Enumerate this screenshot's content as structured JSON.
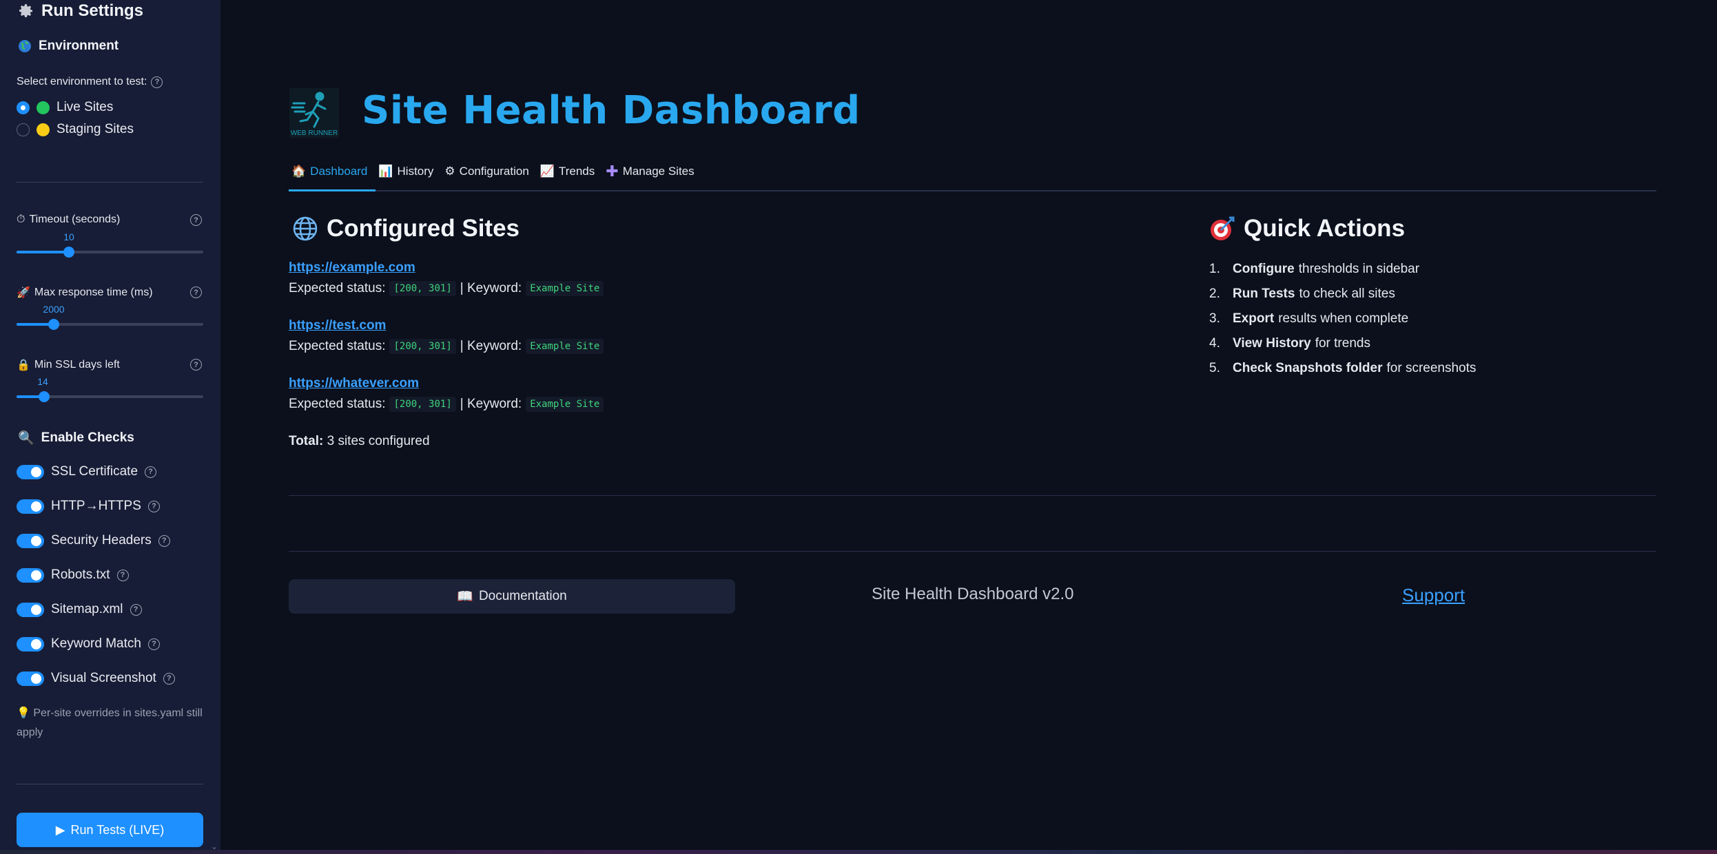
{
  "sidebar": {
    "title": "Run Settings",
    "environment_heading": "Environment",
    "env_select_label": "Select environment to test:",
    "env_options": [
      {
        "label": "Live Sites",
        "color": "#22c55e",
        "selected": true
      },
      {
        "label": "Staging Sites",
        "color": "#facc15",
        "selected": false
      }
    ],
    "timeout": {
      "label": "Timeout (seconds)",
      "value": "10",
      "fraction": 0.18
    },
    "max_response": {
      "label": "Max response time (ms)",
      "value": "2000",
      "fraction": 0.2
    },
    "min_ssl": {
      "label": "Min SSL days left",
      "value": "14",
      "fraction": 0.15
    },
    "checks_heading": "Enable Checks",
    "checks": [
      {
        "label": "SSL Certificate",
        "enabled": true
      },
      {
        "label": "HTTP→HTTPS",
        "enabled": true
      },
      {
        "label": "Security Headers",
        "enabled": true
      },
      {
        "label": "Robots.txt",
        "enabled": true
      },
      {
        "label": "Sitemap.xml",
        "enabled": true
      },
      {
        "label": "Keyword Match",
        "enabled": true
      },
      {
        "label": "Visual Screenshot",
        "enabled": true
      }
    ],
    "tip": "Per-site overrides in sites.yaml still apply",
    "run_button": "Run Tests (LIVE)"
  },
  "header": {
    "logo_text": "WEB RUNNER",
    "title": "Site Health Dashboard"
  },
  "tabs": [
    {
      "label": "Dashboard",
      "icon": "house-icon",
      "active": true
    },
    {
      "label": "History",
      "icon": "bar-chart-icon",
      "active": false
    },
    {
      "label": "Configuration",
      "icon": "gear-icon",
      "active": false
    },
    {
      "label": "Trends",
      "icon": "line-chart-icon",
      "active": false
    },
    {
      "label": "Manage Sites",
      "icon": "plus-icon",
      "active": false
    }
  ],
  "configured": {
    "heading": "Configured Sites",
    "expected_label": "Expected status:",
    "keyword_label": "| Keyword:",
    "sites": [
      {
        "url": "https://example.com",
        "status": "[200, 301]",
        "keyword": "Example Site"
      },
      {
        "url": "https://test.com",
        "status": "[200, 301]",
        "keyword": "Example Site"
      },
      {
        "url": "https://whatever.com",
        "status": "[200, 301]",
        "keyword": "Example Site"
      }
    ],
    "total_label": "Total:",
    "total_text": "3 sites configured"
  },
  "quick_actions": {
    "heading": "Quick Actions",
    "items": [
      {
        "num": "1.",
        "bold": "Configure",
        "rest": "thresholds in sidebar"
      },
      {
        "num": "2.",
        "bold": "Run Tests",
        "rest": "to check all sites"
      },
      {
        "num": "3.",
        "bold": "Export",
        "rest": "results when complete"
      },
      {
        "num": "4.",
        "bold": "View History",
        "rest": "for trends"
      },
      {
        "num": "5.",
        "bold": "Check Snapshots folder",
        "rest": "for screenshots"
      }
    ]
  },
  "footer": {
    "doc_button": "Documentation",
    "version": "Site Health Dashboard v2.0",
    "support": "Support"
  }
}
